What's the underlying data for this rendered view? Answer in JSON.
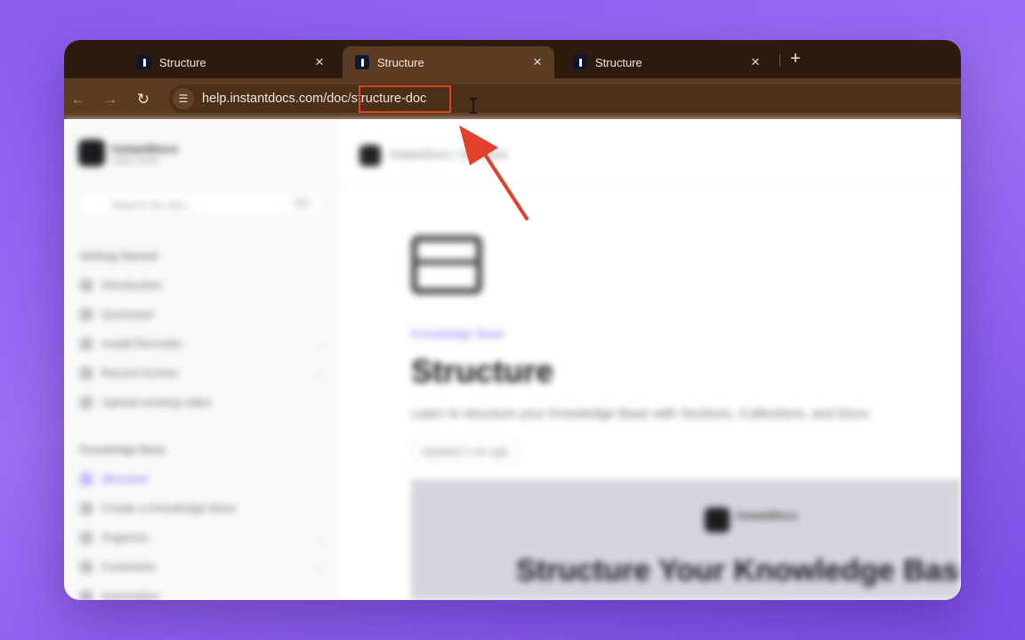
{
  "browser": {
    "tabs": [
      {
        "title": "Structure",
        "active": false
      },
      {
        "title": "Structure",
        "active": true
      },
      {
        "title": "Structure",
        "active": false
      }
    ],
    "new_tab_glyph": "+",
    "close_glyph": "×",
    "url": {
      "host": "help.instantdocs.com/doc",
      "slash": "/",
      "highlighted": "structure-doc"
    },
    "icons": [
      "back-arrow-icon",
      "forward-arrow-icon",
      "reload-icon",
      "site-info-icon",
      "text-cursor-icon",
      "red-arrow-icon"
    ],
    "highlight_color": "#e3402b"
  },
  "page": {
    "brand": {
      "name": "InstantDocs",
      "sub": "Help Center"
    },
    "search_placeholder": "Search for doc...",
    "search_shortcut": "⌘K",
    "sections": [
      {
        "title": "Getting Started",
        "items": [
          {
            "label": "Introduction"
          },
          {
            "label": "Quickstart"
          },
          {
            "label": "Install Recorder"
          },
          {
            "label": "Record Screen"
          },
          {
            "label": "Upload existing video"
          }
        ]
      },
      {
        "title": "Knowledge Base",
        "items": [
          {
            "label": "Structure",
            "active": true
          },
          {
            "label": "Create a Knowledge Base"
          },
          {
            "label": "Organize"
          },
          {
            "label": "Customize"
          },
          {
            "label": "Automation"
          }
        ]
      }
    ],
    "breadcrumb": "InstantDocs  /  Structure",
    "kb_label": "Knowledge Base",
    "title": "Structure",
    "description": "Learn to structure your Knowledge Base with Sections, Collections, and Docs.",
    "updated": "Updated 2 mo ago",
    "hero": {
      "brand": "InstantDocs",
      "title": "Structure Your Knowledge Base"
    }
  }
}
